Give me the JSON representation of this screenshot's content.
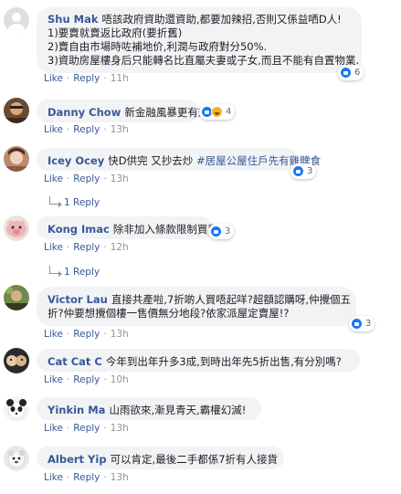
{
  "actions": {
    "like": "Like",
    "reply": "Reply",
    "separator": "·"
  },
  "comments": [
    {
      "author": "Shu Mak",
      "lines": [
        "唔該政府資助還資助,都要加辣招,否則又係益哂D人!",
        "1)要賣就賣返比政府(要折舊)",
        "2)賣自由市場時咗補地价,利潤与政府對分50%.",
        "3)資助房屋樓身后只能轉名比直屬夫妻或子女,而且不能有自置物業."
      ],
      "reactions": {
        "icons": [
          "like-icon"
        ],
        "count": "6"
      },
      "time": "11h"
    },
    {
      "author": "Danny Chow",
      "lines": [
        "新金融風暴更有效"
      ],
      "reactions": {
        "icons": [
          "like-icon",
          "haha-icon"
        ],
        "count": "4"
      },
      "time": "13h"
    },
    {
      "author": "Icey Ocey",
      "lines": [
        "快D供完 又抄去炒"
      ],
      "tag": "#居屋公屋住戶先有雞髀食",
      "reactions": {
        "icons": [
          "like-icon"
        ],
        "count": "3"
      },
      "time": "13h",
      "replies": "1 Reply"
    },
    {
      "author": "Kong Imac",
      "lines": [
        "除非加入條款限制買賣"
      ],
      "reactions": {
        "icons": [
          "like-icon"
        ],
        "count": "3"
      },
      "time": "12h",
      "replies": "1 Reply"
    },
    {
      "author": "Victor Lau",
      "lines": [
        "直接共產啦,7折啲人買唔起咩?超額認購呀,仲攪個五",
        "折?仲要想攪個樓一售價無分地段?依家派屋定賣屋!?"
      ],
      "reactions": {
        "icons": [
          "like-icon"
        ],
        "count": "3"
      },
      "time": "13h"
    },
    {
      "author": "Cat Cat C",
      "lines": [
        "今年到出年升多3成,到時出年先5折出售,有分別嗎?"
      ],
      "time": "10h"
    },
    {
      "author": "Yinkin Ma",
      "lines": [
        "山雨欲來,漸見青天,霸權幻滅!"
      ],
      "time": "13h"
    },
    {
      "author": "Albert Yip",
      "lines": [
        "可以肯定,最後二手都係7折有人接貨"
      ],
      "time": "13h"
    }
  ]
}
